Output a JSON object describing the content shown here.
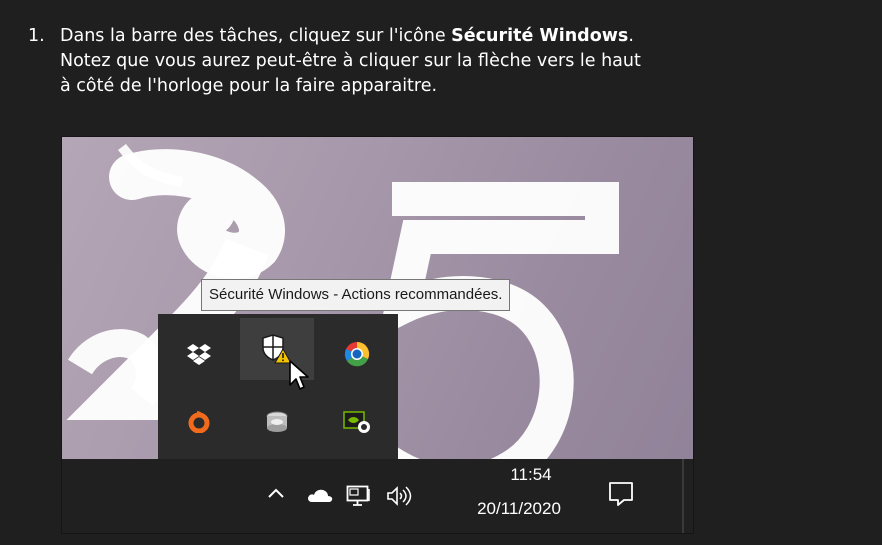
{
  "instruction": {
    "step_number": "1.",
    "line1_before": "Dans la barre des tâches, cliquez sur l'icône ",
    "line1_bold": "Sécurité Windows",
    "line1_after": ".",
    "line2": "Notez que vous aurez peut-être à cliquer sur la flèche vers le haut",
    "line3": "à côté de l'horloge pour la faire apparaitre."
  },
  "tooltip": {
    "text": "Sécurité Windows - Actions recommandées."
  },
  "tray_popup": {
    "icons": [
      "dropbox-icon",
      "windows-security-icon",
      "chrome-canary-icon",
      "origin-icon",
      "storage-icon",
      "nvidia-icon"
    ]
  },
  "taskbar": {
    "clock_time": "11:54",
    "clock_date": "20/11/2020",
    "icons": [
      "chevron-up-icon",
      "onedrive-icon",
      "network-icon",
      "volume-icon",
      "action-center-icon"
    ]
  },
  "colors": {
    "page_background": "#1f1f1f",
    "taskbar": "#202020",
    "tray_popup": "#2b2b2b",
    "tooltip_background": "#f2f2f2"
  }
}
